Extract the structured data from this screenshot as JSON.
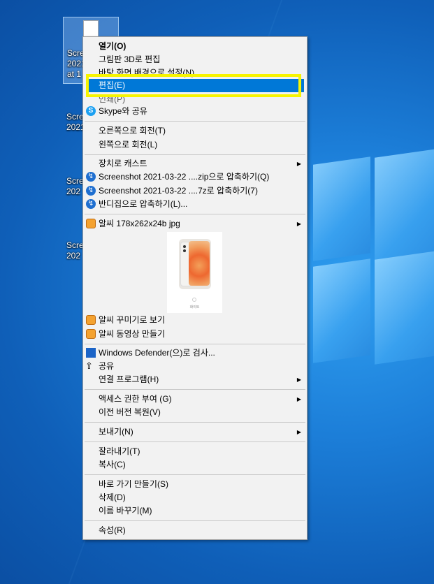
{
  "desktop": {
    "icons": [
      {
        "label": "Scre\n2021\nat 1"
      },
      {
        "label": "Scre\n2021"
      },
      {
        "label": "Scre\n202"
      },
      {
        "label": "Scre\n202"
      }
    ]
  },
  "menu": {
    "open": "열기(O)",
    "paint3d": "그림판 3D로 편집",
    "set_bg": "바탕 화면 배경으로 설정(N)",
    "edit": "편집(E)",
    "print": "인쇄(P)",
    "skype": "Skype와 공유",
    "rotate_right": "오른쪽으로 회전(T)",
    "rotate_left": "왼쪽으로 회전(L)",
    "cast": "장치로 캐스트",
    "zip": "Screenshot 2021-03-22 ....zip으로 압축하기(Q)",
    "sevenz": "Screenshot 2021-03-22 ....7z로 압축하기(7)",
    "bandizip": "반디집으로 압축하기(L)...",
    "alsee_info": "알씨 178x262x24b jpg",
    "preview_caption": "화이트",
    "alsee_decorate": "알씨 꾸미기로 보기",
    "alsee_video": "알씨 동영상 만들기",
    "defender": "Windows Defender(으)로 검사...",
    "share": "공유",
    "open_with": "연결 프로그램(H)",
    "access": "액세스 권한 부여 (G)",
    "restore": "이전 버전 복원(V)",
    "send_to": "보내기(N)",
    "cut": "잘라내기(T)",
    "copy": "복사(C)",
    "shortcut": "바로 가기 만들기(S)",
    "delete": "삭제(D)",
    "rename": "이름 바꾸기(M)",
    "properties": "속성(R)"
  },
  "colors": {
    "highlight": "#0078d7",
    "annotation": "#f7f400",
    "desktop": "#1a74d6"
  }
}
